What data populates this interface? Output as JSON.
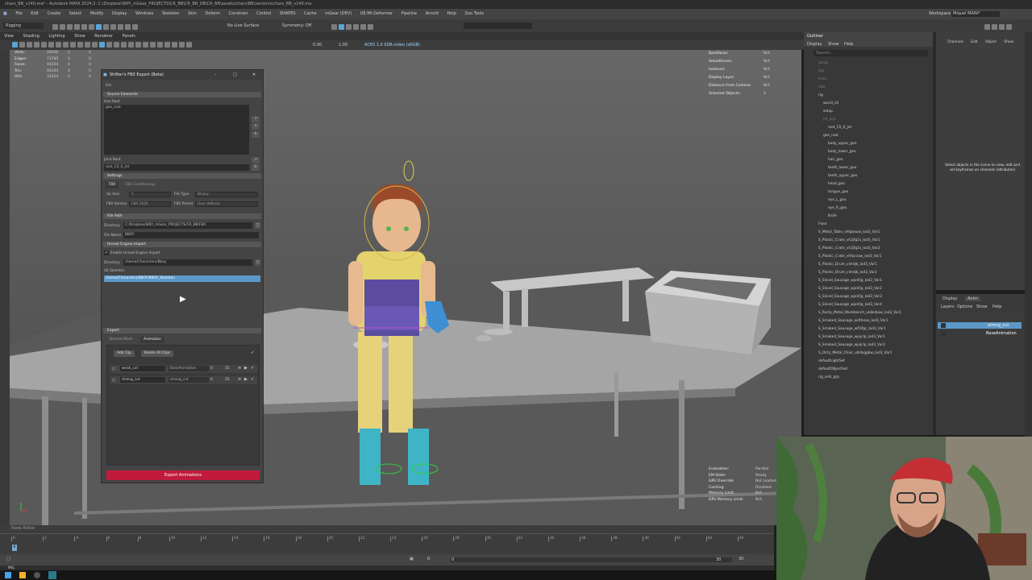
{
  "titlebar": {
    "text": "chars_BB_v140.ma* - Autodesk MAYA 2024.2: C:\\Dropbox\\WIP\\_mGear_PROJECTS\\CR_BB\\CR_BB_DB\\CR_BB\\assets\\chars\\BB\\versions\\chars_BB_v140.ma"
  },
  "menubar": {
    "items": [
      "File",
      "Edit",
      "Create",
      "Select",
      "Modify",
      "Display",
      "Windows",
      "Skeleton",
      "Skin",
      "Deform",
      "Constrain",
      "Control",
      "SHAPES",
      "Cache",
      "mGear (DEV)",
      "UE-Mt.Deformer",
      "Pipeline",
      "Arnold",
      "Help",
      "Zoo Tools"
    ],
    "workspace_label": "Workspace:",
    "workspace_value": "Miquel MAIN*"
  },
  "status_line": {
    "mode": "Rigging",
    "live_surface": "No Live Surface",
    "symmetry": "Symmetry: Off"
  },
  "panel_menu": [
    "View",
    "Shading",
    "Lighting",
    "Show",
    "Renderer",
    "Panels"
  ],
  "panel_toolbar": {
    "gamma": "0.00",
    "exposure": "1.00",
    "color_space": "ACES 1.0 SDR-video (sRGB)"
  },
  "hud_left": [
    {
      "k": "Verts:",
      "v1": "29446",
      "v2": "0",
      "v3": "0"
    },
    {
      "k": "Edges:",
      "v1": "73785",
      "v2": "0",
      "v3": "0"
    },
    {
      "k": "Faces:",
      "v1": "44204",
      "v2": "0",
      "v3": "0"
    },
    {
      "k": "Tris:",
      "v1": "98194",
      "v2": "0",
      "v3": "0"
    },
    {
      "k": "UVs:",
      "v1": "33454",
      "v2": "0",
      "v3": "0"
    }
  ],
  "hud_right": [
    {
      "k": "Backfaces:",
      "v": "N/A"
    },
    {
      "k": "Smoothness:",
      "v": "N/A"
    },
    {
      "k": "Instance:",
      "v": "N/A"
    },
    {
      "k": "Display Layer:",
      "v": "N/A"
    },
    {
      "k": "Distance From Camera:",
      "v": "N/A"
    },
    {
      "k": "Selected Objects:",
      "v": "0"
    }
  ],
  "hud_bottom": [
    {
      "k": "Evaluation:",
      "v": "Parallel"
    },
    {
      "k": "EM State:",
      "v": "Ready"
    },
    {
      "k": "GPU Override:",
      "v": "Not Loaded"
    },
    {
      "k": "Caching:",
      "v": "Disabled"
    },
    {
      "k": "Memory Limit:",
      "v": "N/A"
    },
    {
      "k": "GPU Memory Limit:",
      "v": "N/A"
    }
  ],
  "dialog": {
    "title": "Shifter's FBX Export (Beta)",
    "file_menu": "File",
    "source_section": "Source Elements",
    "geo_root_label": "Geo Root",
    "geo_root_item": "geo_root",
    "joint_root_label": "Joint Root",
    "joint_root_value": "root_C0_0_jnt",
    "settings_section": "Settings",
    "tab_fbx": "FBX",
    "tab_conditioning": "FBX Conditioning",
    "up_axis_label": "Up Axis",
    "up_axis_value": "Y",
    "file_type_label": "File Type",
    "file_type_value": "Binary",
    "fbx_version_label": "FBX Version",
    "fbx_version_value": "FBX 2020",
    "fbx_preset_label": "FBX Preset",
    "fbx_preset_value": "User defined",
    "file_path_section": "File Path",
    "directory_label": "Directory",
    "directory_value": "C:/Dropbox/WIP/_mGear_PROJECTS/CR_BB/FBX",
    "file_name_label": "File Name",
    "file_name_value": "BBOY",
    "unreal_section": "Unreal Engine Import",
    "enable_unreal_label": "Enable Unreal Engine Import",
    "ue_directory_label": "Directory",
    "ue_directory_value": "/Game/Characters/Bboy",
    "ue_skeleton_label": "UE Skeleton",
    "ue_skeleton_value": "/Game/Characters/BBOY/BBOY_Skeleton",
    "export_section": "Export",
    "tab_skeletal_mesh": "Skeletal Mesh",
    "tab_animation": "Animation",
    "add_clip": "Add Clip",
    "delete_all_clips": "Delete All Clips",
    "clips": [
      {
        "name": "weak_cut",
        "layer": "BaseAnimation",
        "start": "0",
        "end": "15"
      },
      {
        "name": "strong_cut",
        "layer": "strong_cut",
        "start": "0",
        "end": "15"
      }
    ],
    "export_button": "Export Animations"
  },
  "outliner": {
    "title": "Outliner",
    "menu": [
      "Display",
      "Show",
      "Help"
    ],
    "search_placeholder": "Search...",
    "items": [
      {
        "label": "persp",
        "indent": 0
      },
      {
        "label": "top",
        "indent": 0
      },
      {
        "label": "front",
        "indent": 0
      },
      {
        "label": "side",
        "indent": 0
      },
      {
        "label": "rig",
        "indent": 0
      },
      {
        "label": "world_ctl",
        "indent": 1
      },
      {
        "label": "setup",
        "indent": 1
      },
      {
        "label": "jnt_org",
        "indent": 1
      },
      {
        "label": "root_C0_0_jnt",
        "indent": 2
      },
      {
        "label": "geo_root",
        "indent": 1
      },
      {
        "label": "body_upper_geo",
        "indent": 2
      },
      {
        "label": "body_lower_geo",
        "indent": 2
      },
      {
        "label": "hair_geo",
        "indent": 2
      },
      {
        "label": "teeth_lower_geo",
        "indent": 2
      },
      {
        "label": "teeth_upper_geo",
        "indent": 2
      },
      {
        "label": "head_geo",
        "indent": 2
      },
      {
        "label": "tongue_geo",
        "indent": 2
      },
      {
        "label": "eye_L_geo",
        "indent": 2
      },
      {
        "label": "eye_R_geo",
        "indent": 2
      },
      {
        "label": "Knife",
        "indent": 2
      },
      {
        "label": "Floor",
        "indent": 0
      },
      {
        "label": "S_Metal_Table_vhfgeaaw_lod3_Var1",
        "indent": 0
      },
      {
        "label": "S_Plastic_Crate_vh2jfg1s_lod3_Var1",
        "indent": 0
      },
      {
        "label": "S_Plastic_Crate_vh2jfg1s_lod3_Var2",
        "indent": 0
      },
      {
        "label": "S_Plastic_Crate_vhfpccaw_lod3_Var1",
        "indent": 0
      },
      {
        "label": "S_Plastic_Drum_vimdjk_lod3_Var1",
        "indent": 0
      },
      {
        "label": "S_Plastic_Drum_vimdjk_lod3_Var2",
        "indent": 0
      },
      {
        "label": "S_Sliced_Sausage_wjxkfjq_lod3_Var1",
        "indent": 0
      },
      {
        "label": "S_Sliced_Sausage_wjxkfjq_lod3_Var2",
        "indent": 0
      },
      {
        "label": "S_Sliced_Sausage_wjxkfjq_lod3_Var3",
        "indent": 0
      },
      {
        "label": "S_Sliced_Sausage_wjxkfjq_lod3_Var4",
        "indent": 0
      },
      {
        "label": "S_Rusty_Metal_Workbench_ukbkdjaw_lod3_Var1",
        "indent": 0
      },
      {
        "label": "S_Smoked_Sausage_wdtheaa_lod3_Var1",
        "indent": 0
      },
      {
        "label": "S_Smoked_Sausage_wfl3fgc_lod3_Var1",
        "indent": 0
      },
      {
        "label": "S_Smoked_Sausage_wjojclp_lod3_Var1",
        "indent": 0
      },
      {
        "label": "S_Smoked_Sausage_wjojclp_lod3_Var2",
        "indent": 0
      },
      {
        "label": "S_Dirty_Metal_Chair_ukldxjgjbw_lod3_Var1",
        "indent": 0
      },
      {
        "label": "defaultLightSet",
        "indent": 0
      },
      {
        "label": "defaultObjectSet",
        "indent": 0
      },
      {
        "label": "rig_sets_grp",
        "indent": 0
      }
    ]
  },
  "channel_box": {
    "menu": [
      "Channels",
      "Edit",
      "Object",
      "Show"
    ],
    "message": "Select objects in the scene to view, edit and set keyframes on channels (attributes)"
  },
  "layer_editor": {
    "tabs": [
      "Display",
      "Anim"
    ],
    "menu": [
      "Layers",
      "Options",
      "Show",
      "Help"
    ],
    "layers": [
      "strong_cut",
      "BaseAnimation"
    ]
  },
  "timeline": {
    "label": "Node Editor",
    "ticks": [
      "0",
      "2",
      "4",
      "6",
      "8",
      "10",
      "12",
      "14",
      "16",
      "18",
      "20",
      "22",
      "24",
      "26",
      "28",
      "30",
      "32",
      "34",
      "36",
      "38",
      "40",
      "42",
      "44",
      "46"
    ],
    "current_frame": "0",
    "range_start": "0",
    "range_inner_start": "0",
    "range_inner_end": "30",
    "range_end": "30"
  },
  "command_line": {
    "label": "MEL"
  }
}
